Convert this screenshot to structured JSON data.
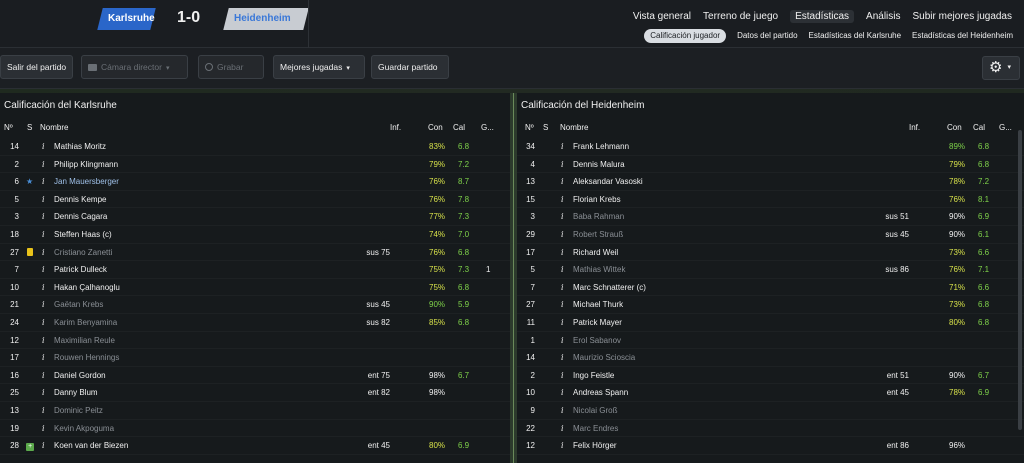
{
  "match": {
    "home": "Karlsruhe",
    "away": "Heidenheim",
    "score": "1-0"
  },
  "topnav": [
    "Vista general",
    "Terreno de juego",
    "Estadísticas",
    "Análisis",
    "Subir mejores jugadas"
  ],
  "subnav": [
    "Calificación jugador",
    "Datos del partido",
    "Estadísticas del Karlsruhe",
    "Estadísticas del Heidenheim"
  ],
  "toolbar": {
    "exit": "Salir del partido",
    "camera": "Cámara director",
    "record": "Grabar",
    "highlights": "Mejores jugadas",
    "save": "Guardar partido"
  },
  "columns": {
    "no": "Nº",
    "s": "S",
    "name": "Nombre",
    "inf": "Inf.",
    "con": "Con",
    "cal": "Cal",
    "g": "G..."
  },
  "home_panel": {
    "title": "Calificación del Karlsruhe",
    "rows": [
      {
        "no": "14",
        "s": "",
        "i": "i",
        "name": "Mathias Moritz",
        "inf": "",
        "con": "83%",
        "cal": "6.8",
        "g": "",
        "con_c": "y",
        "dim": false,
        "star": false
      },
      {
        "no": "2",
        "s": "",
        "i": "i",
        "name": "Philipp Klingmann",
        "inf": "",
        "con": "79%",
        "cal": "7.2",
        "g": "",
        "con_c": "y",
        "dim": false,
        "star": false
      },
      {
        "no": "6",
        "s": "star",
        "i": "i",
        "name": "Jan Mauersberger",
        "inf": "",
        "con": "76%",
        "cal": "8.7",
        "g": "",
        "con_c": "y",
        "dim": false,
        "star": true
      },
      {
        "no": "5",
        "s": "",
        "i": "i",
        "name": "Dennis Kempe",
        "inf": "",
        "con": "76%",
        "cal": "7.8",
        "g": "",
        "con_c": "y",
        "dim": false,
        "star": false
      },
      {
        "no": "3",
        "s": "",
        "i": "i",
        "name": "Dennis Cagara",
        "inf": "",
        "con": "77%",
        "cal": "7.3",
        "g": "",
        "con_c": "y",
        "dim": false,
        "star": false
      },
      {
        "no": "18",
        "s": "",
        "i": "i",
        "name": "Steffen Haas (c)",
        "inf": "",
        "con": "74%",
        "cal": "7.0",
        "g": "",
        "con_c": "y",
        "dim": false,
        "star": false
      },
      {
        "no": "27",
        "s": "card",
        "i": "i",
        "name": "Cristiano Zanetti",
        "inf": "sus 75",
        "con": "76%",
        "cal": "6.8",
        "g": "",
        "con_c": "y",
        "dim": true,
        "star": false
      },
      {
        "no": "7",
        "s": "",
        "i": "i",
        "name": "Patrick Dulleck",
        "inf": "",
        "con": "75%",
        "cal": "7.3",
        "g": "1",
        "con_c": "y",
        "dim": false,
        "star": false
      },
      {
        "no": "10",
        "s": "",
        "i": "i",
        "name": "Hakan Çalhanoglu",
        "inf": "",
        "con": "75%",
        "cal": "6.8",
        "g": "",
        "con_c": "y",
        "dim": false,
        "star": false
      },
      {
        "no": "21",
        "s": "",
        "i": "i",
        "name": "Gaëtan Krebs",
        "inf": "sus 45",
        "con": "90%",
        "cal": "5.9",
        "g": "",
        "con_c": "g",
        "dim": true,
        "star": false
      },
      {
        "no": "24",
        "s": "",
        "i": "i",
        "name": "Karim Benyamina",
        "inf": "sus 82",
        "con": "85%",
        "cal": "6.8",
        "g": "",
        "con_c": "y",
        "dim": true,
        "star": false
      },
      {
        "no": "12",
        "s": "",
        "i": "i",
        "name": "Maximilian Reule",
        "inf": "",
        "con": "",
        "cal": "",
        "g": "",
        "con_c": "w",
        "dim": true,
        "star": false
      },
      {
        "no": "17",
        "s": "",
        "i": "i",
        "name": "Rouwen Hennings",
        "inf": "",
        "con": "",
        "cal": "",
        "g": "",
        "con_c": "w",
        "dim": true,
        "star": false
      },
      {
        "no": "16",
        "s": "",
        "i": "i",
        "name": "Daniel Gordon",
        "inf": "ent 75",
        "con": "98%",
        "cal": "6.7",
        "g": "",
        "con_c": "w",
        "dim": false,
        "star": false
      },
      {
        "no": "25",
        "s": "",
        "i": "i",
        "name": "Danny Blum",
        "inf": "ent 82",
        "con": "98%",
        "cal": "",
        "g": "",
        "con_c": "w",
        "dim": false,
        "star": false
      },
      {
        "no": "13",
        "s": "",
        "i": "i",
        "name": "Dominic Peitz",
        "inf": "",
        "con": "",
        "cal": "",
        "g": "",
        "con_c": "w",
        "dim": true,
        "star": false
      },
      {
        "no": "19",
        "s": "",
        "i": "i",
        "name": "Kevin Akpoguma",
        "inf": "",
        "con": "",
        "cal": "",
        "g": "",
        "con_c": "w",
        "dim": true,
        "star": false
      },
      {
        "no": "28",
        "s": "sub",
        "i": "i",
        "name": "Koen van der Biezen",
        "inf": "ent 45",
        "con": "80%",
        "cal": "6.9",
        "g": "",
        "con_c": "y",
        "dim": false,
        "star": false
      }
    ]
  },
  "away_panel": {
    "title": "Calificación del Heidenheim",
    "rows": [
      {
        "no": "34",
        "s": "",
        "i": "i",
        "name": "Frank Lehmann",
        "inf": "",
        "con": "89%",
        "cal": "6.8",
        "con_c": "g",
        "dim": false
      },
      {
        "no": "4",
        "s": "",
        "i": "i",
        "name": "Dennis Malura",
        "inf": "",
        "con": "79%",
        "cal": "6.8",
        "con_c": "y",
        "dim": false
      },
      {
        "no": "13",
        "s": "",
        "i": "i",
        "name": "Aleksandar Vasoski",
        "inf": "",
        "con": "78%",
        "cal": "7.2",
        "con_c": "y",
        "dim": false
      },
      {
        "no": "15",
        "s": "",
        "i": "i",
        "name": "Florian Krebs",
        "inf": "",
        "con": "76%",
        "cal": "8.1",
        "con_c": "y",
        "dim": false
      },
      {
        "no": "3",
        "s": "",
        "i": "i",
        "name": "Baba Rahman",
        "inf": "sus 51",
        "con": "90%",
        "cal": "6.9",
        "con_c": "w",
        "dim": true
      },
      {
        "no": "29",
        "s": "",
        "i": "i",
        "name": "Robert Strauß",
        "inf": "sus 45",
        "con": "90%",
        "cal": "6.1",
        "con_c": "w",
        "dim": true
      },
      {
        "no": "17",
        "s": "",
        "i": "i",
        "name": "Richard Weil",
        "inf": "",
        "con": "73%",
        "cal": "6.6",
        "con_c": "y",
        "dim": false
      },
      {
        "no": "5",
        "s": "",
        "i": "i",
        "name": "Mathias Wittek",
        "inf": "sus 86",
        "con": "76%",
        "cal": "7.1",
        "con_c": "y",
        "dim": true
      },
      {
        "no": "7",
        "s": "",
        "i": "i",
        "name": "Marc Schnatterer (c)",
        "inf": "",
        "con": "71%",
        "cal": "6.6",
        "con_c": "y",
        "dim": false
      },
      {
        "no": "27",
        "s": "",
        "i": "i",
        "name": "Michael Thurk",
        "inf": "",
        "con": "73%",
        "cal": "6.8",
        "con_c": "y",
        "dim": false
      },
      {
        "no": "11",
        "s": "",
        "i": "i",
        "name": "Patrick Mayer",
        "inf": "",
        "con": "80%",
        "cal": "6.8",
        "con_c": "y",
        "dim": false
      },
      {
        "no": "1",
        "s": "",
        "i": "i",
        "name": "Erol Sabanov",
        "inf": "",
        "con": "",
        "cal": "",
        "con_c": "w",
        "dim": true
      },
      {
        "no": "14",
        "s": "",
        "i": "i",
        "name": "Maurizio Scioscia",
        "inf": "",
        "con": "",
        "cal": "",
        "con_c": "w",
        "dim": true
      },
      {
        "no": "2",
        "s": "",
        "i": "i",
        "name": "Ingo Feistle",
        "inf": "ent 51",
        "con": "90%",
        "cal": "6.7",
        "con_c": "w",
        "dim": false
      },
      {
        "no": "10",
        "s": "",
        "i": "i",
        "name": "Andreas Spann",
        "inf": "ent 45",
        "con": "78%",
        "cal": "6.9",
        "con_c": "y",
        "dim": false
      },
      {
        "no": "9",
        "s": "",
        "i": "i",
        "name": "Nicolai Groß",
        "inf": "",
        "con": "",
        "cal": "",
        "con_c": "w",
        "dim": true
      },
      {
        "no": "22",
        "s": "",
        "i": "i",
        "name": "Marc Endres",
        "inf": "",
        "con": "",
        "cal": "",
        "con_c": "w",
        "dim": true
      },
      {
        "no": "12",
        "s": "",
        "i": "i",
        "name": "Felix Hörger",
        "inf": "ent 86",
        "con": "96%",
        "cal": "",
        "con_c": "w",
        "dim": false
      }
    ]
  }
}
